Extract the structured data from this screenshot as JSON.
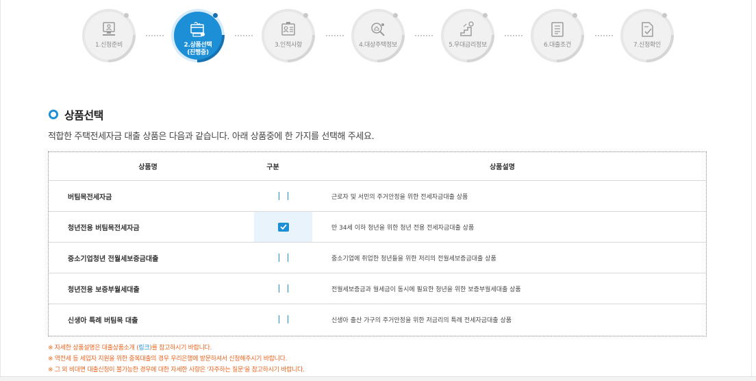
{
  "steps": [
    {
      "label": "1.신청준비",
      "icon": "monitor-icon"
    },
    {
      "label": "2.상품선택",
      "sub": "(진행중)",
      "icon": "card-icon"
    },
    {
      "label": "3.인적사항",
      "icon": "id-card-icon"
    },
    {
      "label": "4.대상주택정보",
      "icon": "search-house-icon"
    },
    {
      "label": "5.우대금리정보",
      "icon": "stairs-coin-icon"
    },
    {
      "label": "6.대출조건",
      "icon": "document-list-icon"
    },
    {
      "label": "7.신청확인",
      "icon": "document-check-icon"
    }
  ],
  "active_step": 2,
  "section": {
    "title": "상품선택",
    "description": "적합한 주택전세자금 대출 상품은 다음과 같습니다. 아래 상품중에 한 가지를 선택해 주세요."
  },
  "table": {
    "headers": {
      "name": "상품명",
      "type": "구분",
      "desc": "상품설명"
    },
    "rows": [
      {
        "name": "버팀목전세자금",
        "desc": "근로자 및 서민의 주거안정을 위한 전세자금대출 상품",
        "checked": false
      },
      {
        "name": "청년전용 버팀목전세자금",
        "desc": "만 34세 이하 청년을 위한 청년 전용 전세자금대출 상품",
        "checked": true
      },
      {
        "name": "중소기업청년 전월세보증금대출",
        "desc": "중소기업에 취업한 청년들을 위한 저리의 전월세보증금대출 상품",
        "checked": false
      },
      {
        "name": "청년전용 보증부월세대출",
        "desc": "전월세보증금과 월세금이 동시에 필요한 청년을 위한 보증부월세대출 상품",
        "checked": false
      },
      {
        "name": "신생아 특례 버팀목 대출",
        "desc": "신생아 출산 가구의 주거안정을 위한 저금리의 특례 전세자금대출 상품",
        "checked": false
      }
    ]
  },
  "notes": {
    "n1_pre": "※ 자세한 상품설명은 대출상품소개 (",
    "n1_link": "링크",
    "n1_post": ")를 참고하시기 바랍니다.",
    "n2": "※ 역전세 등 세입자 지원을 위한 중복대출의 경우 우리은행에 방문하셔서 신청해주시기 바랍니다.",
    "n3": "※ 그 외 비대면 대출신청이 불가능한 경우에 대한 자세한 사항은 '자주하는 질문'을 참고하시기 바랍니다."
  },
  "colors": {
    "accent": "#1c8fd6",
    "note": "#e8641e"
  }
}
